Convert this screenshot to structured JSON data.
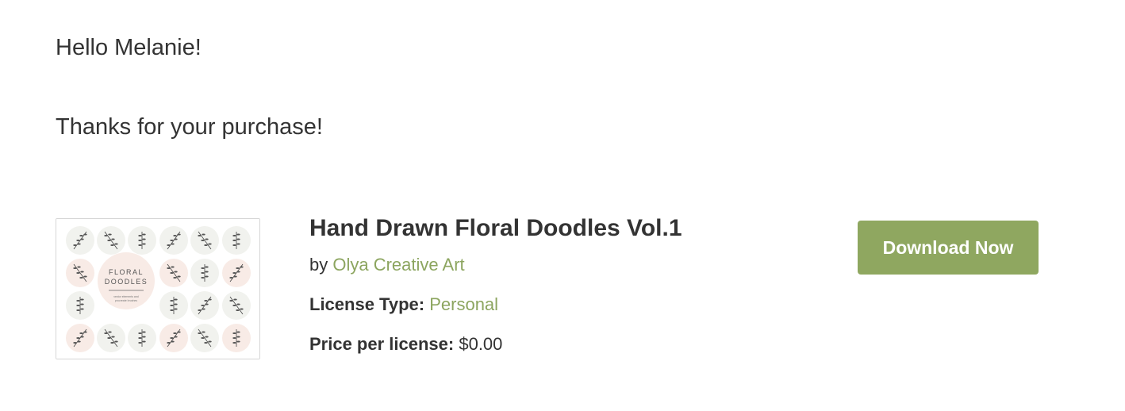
{
  "greeting": "Hello Melanie!",
  "thanks": "Thanks for your purchase!",
  "product": {
    "title": "Hand Drawn Floral Doodles Vol.1",
    "by_prefix": "by",
    "author": "Olya Creative Art",
    "license_label": "License Type:",
    "license_value": "Personal",
    "price_label": "Price per license:",
    "price_value": "$0.00",
    "thumbnail": {
      "title_line1": "FLORAL",
      "title_line2": "DOODLES",
      "subtitle_line1": "vector elements and",
      "subtitle_line2": "procreate brushes"
    }
  },
  "download_button": "Download Now",
  "colors": {
    "accent": "#8ca55f",
    "button": "#8fa760",
    "text": "#333333"
  }
}
